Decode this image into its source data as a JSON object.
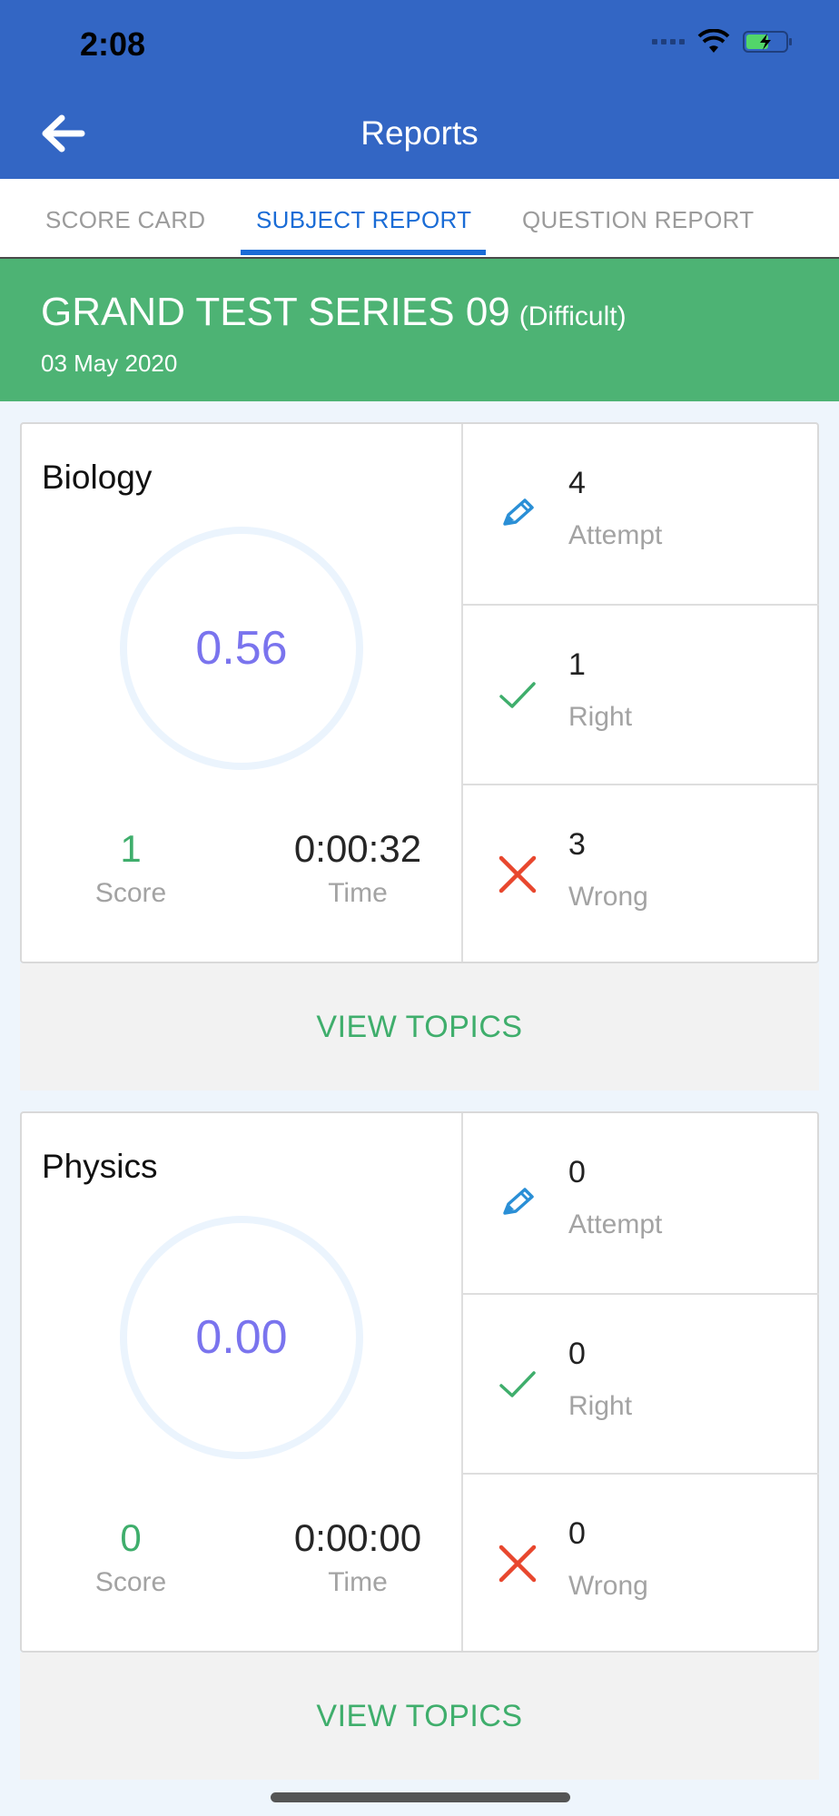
{
  "status_bar": {
    "time": "2:08"
  },
  "header": {
    "title": "Reports"
  },
  "tabs": [
    {
      "label": "SCORE CARD",
      "active": false
    },
    {
      "label": "SUBJECT REPORT",
      "active": true
    },
    {
      "label": "QUESTION REPORT",
      "active": false
    }
  ],
  "test": {
    "title": "GRAND TEST SERIES 09",
    "difficulty": "(Difficult)",
    "date": "03 May 2020"
  },
  "subjects": [
    {
      "name": "Biology",
      "ring_value": "0.56",
      "score": "1",
      "score_label": "Score",
      "time": "0:00:32",
      "time_label": "Time",
      "attempt": "4",
      "attempt_label": "Attempt",
      "right": "1",
      "right_label": "Right",
      "wrong": "3",
      "wrong_label": "Wrong",
      "view_topics": "VIEW TOPICS"
    },
    {
      "name": "Physics",
      "ring_value": "0.00",
      "score": "0",
      "score_label": "Score",
      "time": "0:00:00",
      "time_label": "Time",
      "attempt": "0",
      "attempt_label": "Attempt",
      "right": "0",
      "right_label": "Right",
      "wrong": "0",
      "wrong_label": "Wrong",
      "view_topics": "VIEW TOPICS"
    }
  ],
  "colors": {
    "header": "#3366c4",
    "banner": "#4db374",
    "accent_tab": "#1a6cd6",
    "ring_text": "#7a74ee",
    "score": "#3fae6c",
    "wrong": "#e8472e"
  },
  "icons": {
    "attempt": "pencil-icon",
    "right": "check-icon",
    "wrong": "cross-icon",
    "back": "back-arrow-icon"
  }
}
